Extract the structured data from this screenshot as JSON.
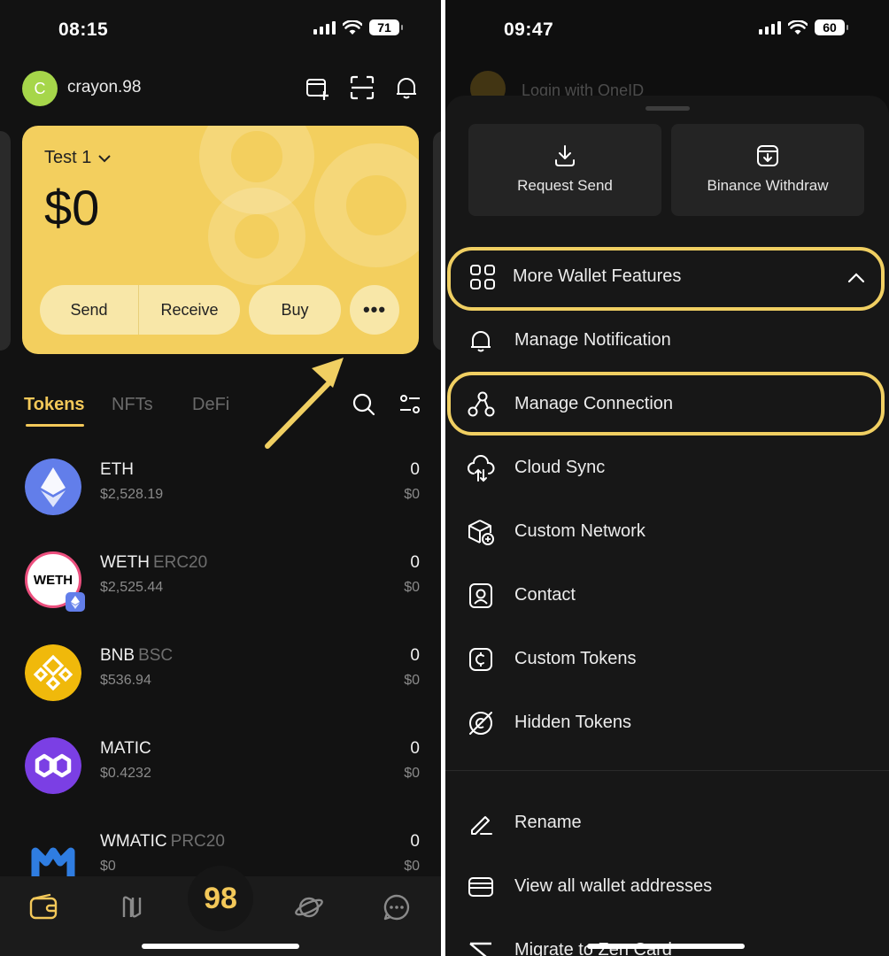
{
  "left": {
    "status": {
      "time": "08:15",
      "battery": "71"
    },
    "header": {
      "avatar_letter": "C",
      "username": "crayon.98"
    },
    "card": {
      "wallet_name": "Test 1",
      "balance": "$0",
      "buttons": {
        "send": "Send",
        "receive": "Receive",
        "buy": "Buy",
        "more": "•••"
      }
    },
    "tabs": {
      "tokens": "Tokens",
      "nfts": "NFTs",
      "defi": "DeFi"
    },
    "tokens": [
      {
        "symbol": "ETH",
        "network": "",
        "price": "$2,528.19",
        "amount": "0",
        "value": "$0"
      },
      {
        "symbol": "WETH",
        "network": "ERC20",
        "price": "$2,525.44",
        "amount": "0",
        "value": "$0",
        "logo_text": "WETH"
      },
      {
        "symbol": "BNB",
        "network": "BSC",
        "price": "$536.94",
        "amount": "0",
        "value": "$0"
      },
      {
        "symbol": "MATIC",
        "network": "",
        "price": "$0.4232",
        "amount": "0",
        "value": "$0"
      },
      {
        "symbol": "WMATIC",
        "network": "PRC20",
        "price": "$0",
        "amount": "0",
        "value": "$0"
      }
    ],
    "nav": {
      "center_logo": "98"
    }
  },
  "right": {
    "status": {
      "time": "09:47",
      "battery": "60"
    },
    "behind_text": "Login with OneID",
    "quick_actions": [
      {
        "label": "Request Send",
        "icon": "download-icon"
      },
      {
        "label": "Binance Withdraw",
        "icon": "withdraw-icon"
      }
    ],
    "menu": [
      {
        "label": "More Wallet Features",
        "icon": "grid-icon"
      },
      {
        "label": "Manage Notification",
        "icon": "bell-icon"
      },
      {
        "label": "Manage Connection",
        "icon": "connection-icon"
      },
      {
        "label": "Cloud Sync",
        "icon": "cloud-sync-icon"
      },
      {
        "label": "Custom Network",
        "icon": "cube-add-icon"
      },
      {
        "label": "Contact",
        "icon": "contact-icon"
      },
      {
        "label": "Custom Tokens",
        "icon": "coin-icon"
      },
      {
        "label": "Hidden Tokens",
        "icon": "hidden-icon"
      },
      {
        "label": "Rename",
        "icon": "pencil-icon"
      },
      {
        "label": "View all wallet addresses",
        "icon": "wallet-card-icon"
      },
      {
        "label": "Migrate to Zen Card",
        "icon": "migrate-icon"
      }
    ]
  },
  "colors": {
    "accent": "#f3c859",
    "card": "#f3cf5e",
    "highlight": "#f0cf62",
    "background": "#121212"
  }
}
